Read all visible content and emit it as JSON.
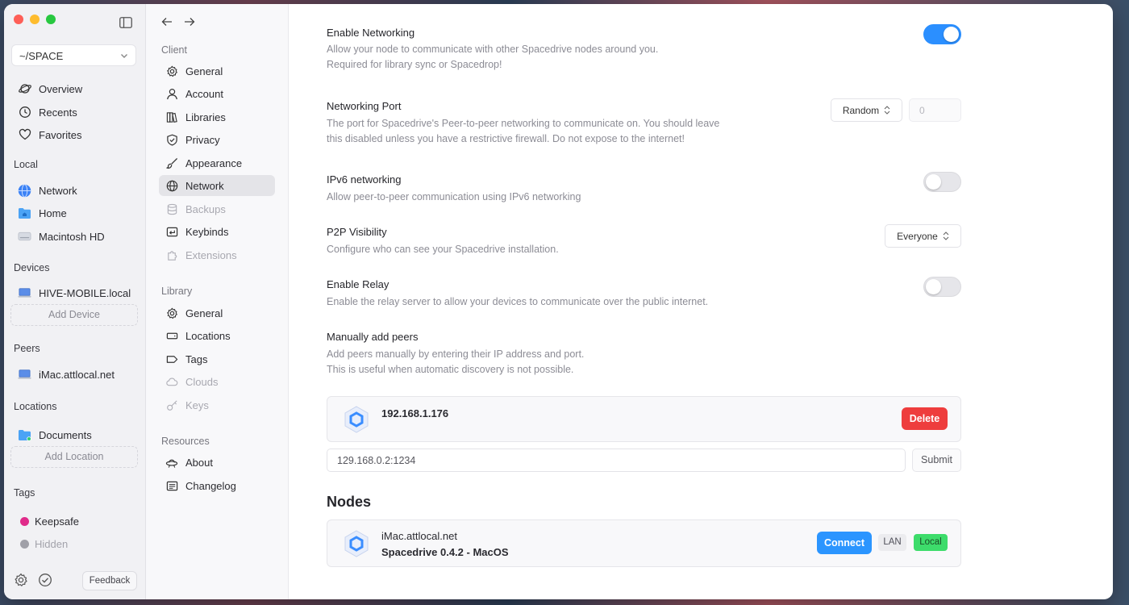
{
  "sidebar": {
    "library_name": "~/SPACE",
    "main_items": [
      {
        "label": "Overview",
        "icon": "planet-icon"
      },
      {
        "label": "Recents",
        "icon": "clock-icon"
      },
      {
        "label": "Favorites",
        "icon": "heart-icon"
      }
    ],
    "local_header": "Local",
    "local_items": [
      {
        "label": "Network",
        "icon": "globe-icon"
      },
      {
        "label": "Home",
        "icon": "home-folder-icon"
      },
      {
        "label": "Macintosh HD",
        "icon": "drive-icon"
      }
    ],
    "devices_header": "Devices",
    "device_name": "HIVE-MOBILE.local",
    "add_device_label": "Add Device",
    "peers_header": "Peers",
    "peer_name": "iMac.attlocal.net",
    "locations_header": "Locations",
    "location_name": "Documents",
    "add_location_label": "Add Location",
    "tags_header": "Tags",
    "tags": [
      {
        "label": "Keepsafe",
        "color": "#e02b8a"
      },
      {
        "label": "Hidden",
        "color": "#a0a0a8"
      }
    ],
    "feedback_label": "Feedback"
  },
  "nav": {
    "client_header": "Client",
    "client_items": [
      {
        "label": "General",
        "icon": "gear-icon"
      },
      {
        "label": "Account",
        "icon": "user-icon"
      },
      {
        "label": "Libraries",
        "icon": "books-icon"
      },
      {
        "label": "Privacy",
        "icon": "shield-check-icon"
      },
      {
        "label": "Appearance",
        "icon": "paintbrush-icon"
      },
      {
        "label": "Network",
        "icon": "globe-icon"
      },
      {
        "label": "Backups",
        "icon": "database-icon"
      },
      {
        "label": "Keybinds",
        "icon": "keyboard-return-icon"
      },
      {
        "label": "Extensions",
        "icon": "puzzle-icon"
      }
    ],
    "library_header": "Library",
    "library_items": [
      {
        "label": "General",
        "icon": "gear-icon"
      },
      {
        "label": "Locations",
        "icon": "hard-drive-icon"
      },
      {
        "label": "Tags",
        "icon": "tag-icon"
      },
      {
        "label": "Clouds",
        "icon": "cloud-icon"
      },
      {
        "label": "Keys",
        "icon": "key-icon"
      }
    ],
    "resources_header": "Resources",
    "resources_items": [
      {
        "label": "About",
        "icon": "ufo-icon"
      },
      {
        "label": "Changelog",
        "icon": "list-icon"
      }
    ]
  },
  "settings": {
    "enable_networking": {
      "title": "Enable Networking",
      "desc1": "Allow your node to communicate with other Spacedrive nodes around you.",
      "desc2": "Required for library sync or Spacedrop!"
    },
    "networking_port": {
      "title": "Networking Port",
      "desc1": "The port for Spacedrive's Peer-to-peer networking to communicate on. You should leave",
      "desc2": "this disabled unless you have a restrictive firewall. Do not expose to the internet!",
      "mode": "Random",
      "port_placeholder": "0"
    },
    "ipv6": {
      "title": "IPv6 networking",
      "desc": "Allow peer-to-peer communication using IPv6 networking"
    },
    "p2p_visibility": {
      "title": "P2P Visibility",
      "desc": "Configure who can see your Spacedrive installation.",
      "value": "Everyone"
    },
    "relay": {
      "title": "Enable Relay",
      "desc": "Enable the relay server to allow your devices to communicate over the public internet."
    },
    "manual_peers": {
      "title": "Manually add peers",
      "desc1": "Add peers manually by entering their IP address and port.",
      "desc2": "This is useful when automatic discovery is not possible.",
      "peer_ip": "192.168.1.176",
      "delete_label": "Delete",
      "input_value": "129.168.0.2:1234",
      "submit_label": "Submit"
    }
  },
  "nodes": {
    "header": "Nodes",
    "node_name": "iMac.attlocal.net",
    "node_version": "Spacedrive 0.4.2 - MacOS",
    "connect_label": "Connect",
    "badge_lan": "LAN",
    "badge_local": "Local"
  },
  "colors": {
    "accent": "#2b8fff",
    "danger": "#ee3d3d",
    "success": "#3ddc6b"
  }
}
